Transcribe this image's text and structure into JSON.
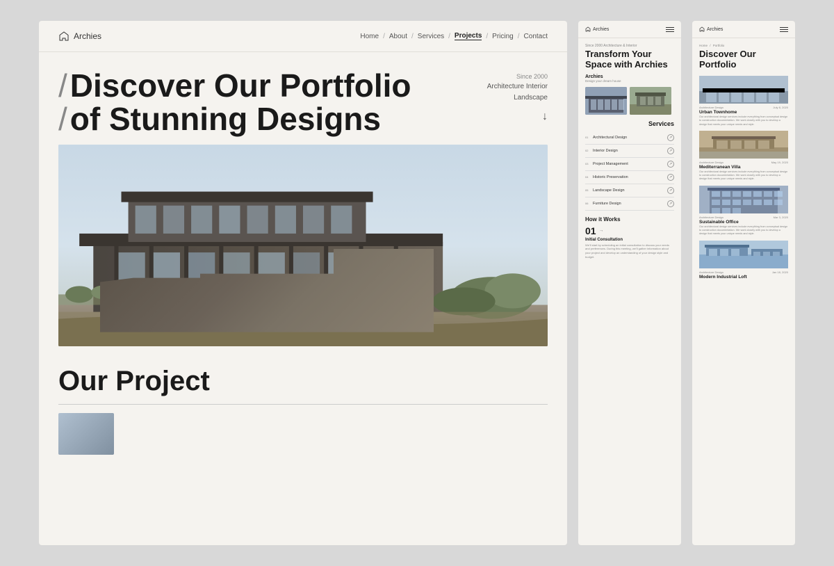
{
  "main": {
    "logo": "Archies",
    "nav": {
      "items": [
        "Home",
        "About",
        "Services",
        "Projects",
        "Pricing",
        "Contact"
      ],
      "active": "Projects"
    },
    "hero": {
      "since": "Since 2000",
      "title_line1": "Discover Our Portfolio",
      "title_line2": "of Stunning Designs",
      "subtitle": "Architecture Interior\nLandscape",
      "scroll_label": "↓"
    },
    "section_project": "Our Project"
  },
  "middle": {
    "logo": "Archies",
    "hero": {
      "since": "Since 2000 Architecture & Interior",
      "title": "Transform Your Space with Archies",
      "company": "Archies",
      "tagline": "Design your dream house"
    },
    "services": {
      "heading": "Services",
      "items": [
        {
          "num": "01",
          "name": "Architectural Design"
        },
        {
          "num": "02",
          "name": "Interior Design"
        },
        {
          "num": "03",
          "name": "Project Management"
        },
        {
          "num": "04",
          "name": "Historic Preservation"
        },
        {
          "num": "05",
          "name": "Landscape Design"
        },
        {
          "num": "06",
          "name": "Furniture Design"
        }
      ]
    },
    "how_it_works": {
      "heading": "How it Works",
      "step_num": "01",
      "step_title": "Initial Consultation",
      "step_text": "We'll start by scheduling an initial consultation to discuss your needs and preferences. During this meeting, we'll gather information about your project and develop an understanding of your design style and budget."
    }
  },
  "right": {
    "logo": "Archies",
    "breadcrumb": [
      "Home",
      "Portfolio"
    ],
    "hero_title": "Discover Our Portfolio",
    "portfolio": [
      {
        "category": "Architecture Design",
        "date": "July 8, 2020",
        "title": "Urban Townhome",
        "text": "Our architectural design services include everything from conceptual design to construction documentation. We work closely with you to develop a design that meets your unique needs and style.",
        "img_class": "img-blue"
      },
      {
        "category": "Architecture Design",
        "date": "May 19, 2020",
        "title": "Mediterranean Villa",
        "text": "Our architectural design services include everything from conceptual design to construction documentation. We work closely with you to develop a design that meets your unique needs and style.",
        "img_class": "img-tan"
      },
      {
        "category": "Architecture Design",
        "date": "Mar 3, 2020",
        "title": "Sustainable Office",
        "text": "Our architectural design services include everything from conceptual design to construction documentation. We work closely with you to develop a design that meets your unique needs and style.",
        "img_class": "img-steel"
      },
      {
        "category": "Architecture Design",
        "date": "Jan 18, 2020",
        "title": "Modern Industrial Loft",
        "text": "",
        "img_class": "img-sky"
      }
    ]
  }
}
